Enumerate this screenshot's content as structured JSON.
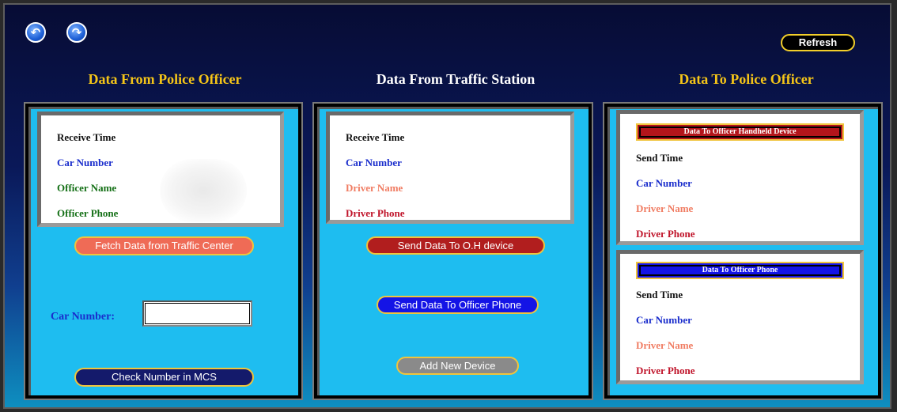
{
  "nav": {
    "back_label": "↶",
    "forward_label": "↷"
  },
  "refresh_label": "Refresh",
  "columns": {
    "police_in": {
      "title": "Data From Police Officer",
      "fields": [
        "Receive Time",
        "Car Number",
        "Officer Name",
        "Officer Phone"
      ],
      "fetch_button": "Fetch Data from Traffic Center",
      "car_number_label": "Car Number:",
      "car_number_value": "",
      "check_button": "Check Number in MCS"
    },
    "traffic": {
      "title": "Data From Traffic Station",
      "fields": [
        "Receive Time",
        "Car Number",
        "Driver Name",
        "Driver Phone"
      ],
      "send_oh_button": "Send Data To O.H device",
      "send_phone_button": "Send Data To Officer Phone",
      "add_device_button": "Add New Device"
    },
    "police_out": {
      "title": "Data To Police Officer",
      "handheld_header": "Data To Officer Handheld Device",
      "handheld_fields": [
        "Send Time",
        "Car Number",
        "Driver Name",
        "Driver Phone"
      ],
      "phone_header": "Data To Officer Phone",
      "phone_fields": [
        "Send Time",
        "Car Number",
        "Driver Name",
        "Driver Phone"
      ]
    }
  },
  "colors": {
    "title_gold": "#f5c518",
    "panel_bg": "#1ebdf0",
    "handheld_bar": "#b3151b",
    "phone_bar": "#1414e6"
  }
}
